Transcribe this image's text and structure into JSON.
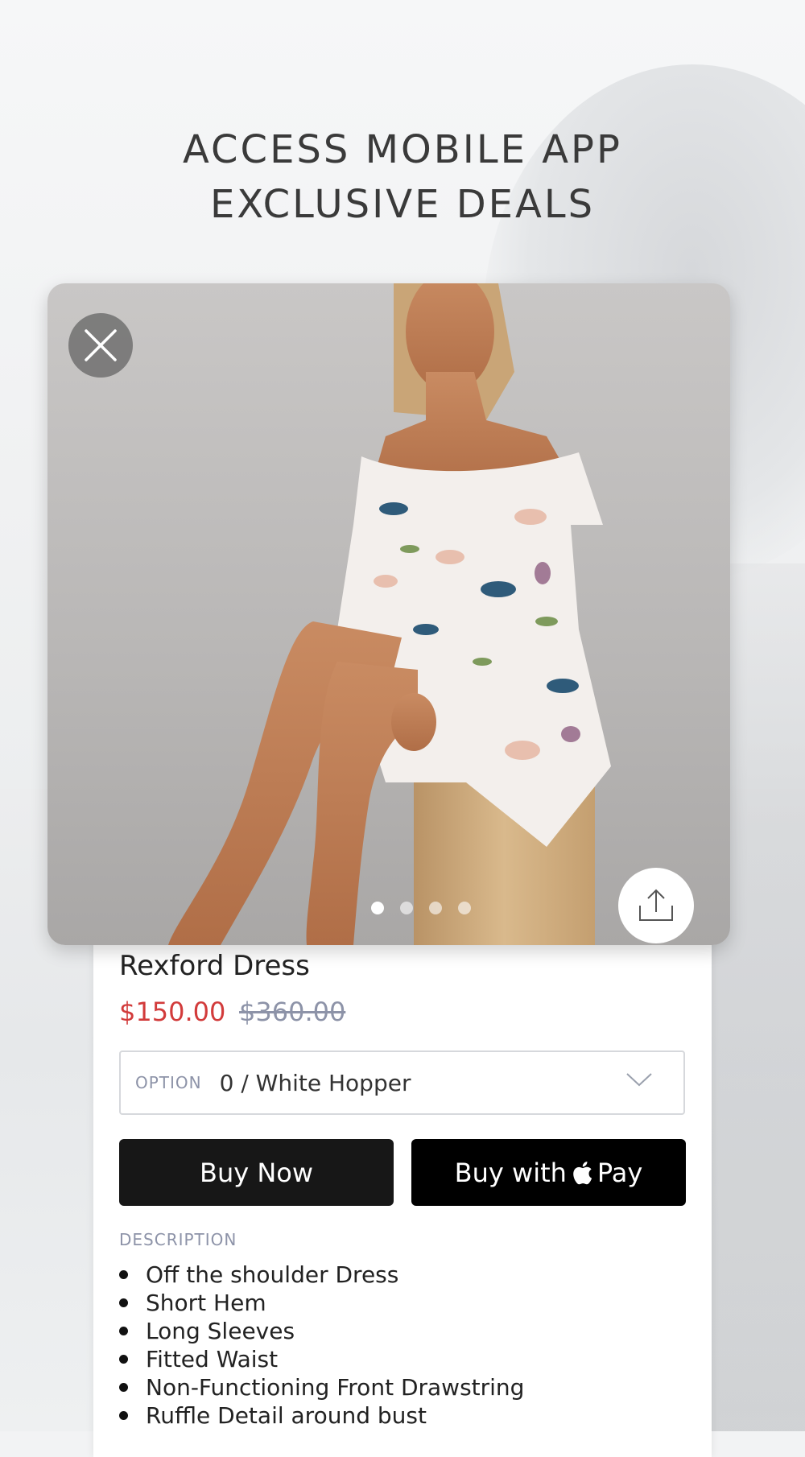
{
  "headline": {
    "line1": "ACCESS MOBILE APP",
    "line2": "EXCLUSIVE DEALS"
  },
  "product": {
    "name": "Rexford Dress",
    "price": "$150.00",
    "compare_price": "$360.00",
    "option": {
      "label": "OPTION",
      "value": "0 / White Hopper"
    },
    "buttons": {
      "buy_now": "Buy Now",
      "apple_pay_prefix": "Buy with",
      "apple_pay_suffix": "Pay"
    },
    "gallery": {
      "count": 4,
      "active_index": 0
    },
    "description": {
      "heading": "DESCRIPTION",
      "items": [
        "Off the shoulder Dress",
        "Short Hem",
        "Long Sleeves",
        "Fitted Waist",
        "Non-Functioning Front Drawstring",
        "Ruffle Detail around bust"
      ]
    }
  },
  "icons": [
    "close-icon",
    "share-icon",
    "chevron-down-icon",
    "apple-logo-icon"
  ],
  "colors": {
    "sale_price": "#d23b3b",
    "muted_label": "#8d93a8",
    "button_dark": "#171717"
  }
}
